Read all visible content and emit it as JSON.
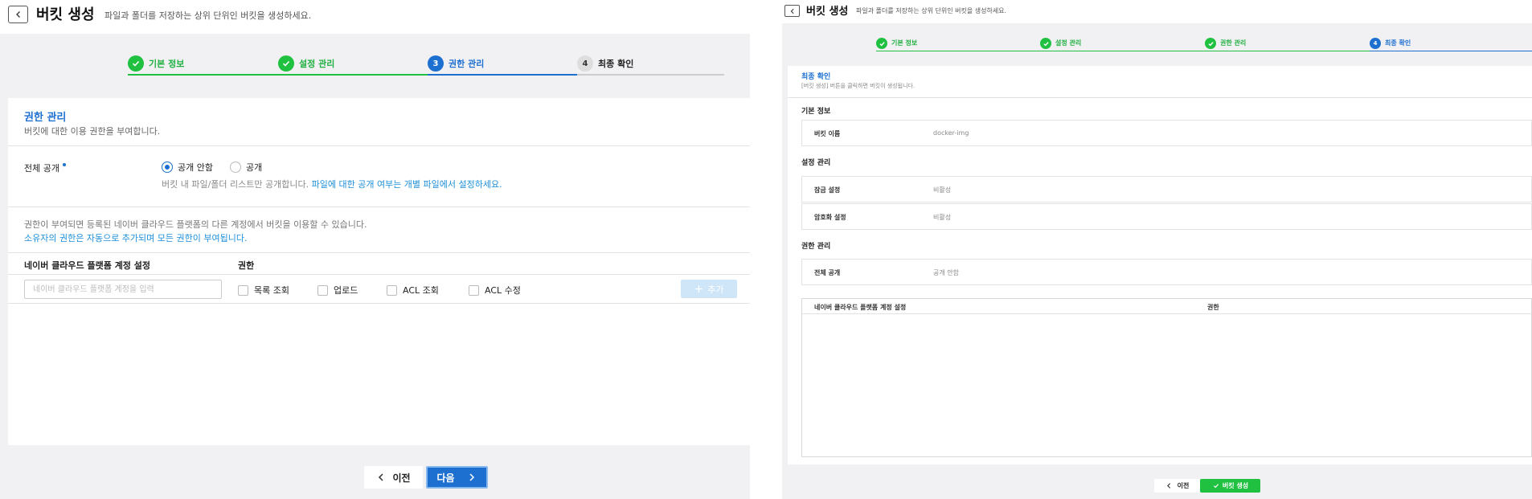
{
  "left": {
    "title": "버킷 생성",
    "subtitle": "파일과 폴더를 저장하는 상위 단위인 버킷을 생성하세요.",
    "steps": [
      {
        "num": "1",
        "label": "기본 정보",
        "state": "done"
      },
      {
        "num": "2",
        "label": "설정 관리",
        "state": "done"
      },
      {
        "num": "3",
        "label": "권한 관리",
        "state": "current"
      },
      {
        "num": "4",
        "label": "최종 확인",
        "state": "todo"
      }
    ],
    "section": {
      "title": "권한 관리",
      "description": "버킷에 대한 이용 권한을 부여합니다."
    },
    "public_access": {
      "label": "전체 공개",
      "options": [
        {
          "label": "공개 안함",
          "selected": true
        },
        {
          "label": "공개",
          "selected": false
        }
      ],
      "hint": "버킷 내 파일/폴더 리스트만 공개합니다. ",
      "hint_link": "파일에 대한 공개 여부는 개별 파일에서 설정하세요."
    },
    "info_line1": "권한이 부여되면 등록된 네이버 클라우드 플랫폼의 다른 계정에서 버킷을 이용할 수 있습니다.",
    "info_line2": "소유자의 권한은 자동으로 추가되며 모든 권한이 부여됩니다.",
    "table": {
      "col_account": "네이버 클라우드 플랫폼 계정 설정",
      "col_permission": "권한",
      "account_placeholder": "네이버 클라우드 플랫폼 계정을 입력",
      "permissions": [
        "목록 조회",
        "업로드",
        "ACL 조회",
        "ACL 수정"
      ],
      "add_label": "추가"
    },
    "prev_label": "이전",
    "next_label": "다음"
  },
  "right": {
    "title": "버킷 생성",
    "subtitle": "파일과 폴더를 저장하는 상위 단위인 버킷을 생성하세요.",
    "steps": [
      {
        "num": "1",
        "label": "기본 정보",
        "state": "done"
      },
      {
        "num": "2",
        "label": "설정 관리",
        "state": "done"
      },
      {
        "num": "3",
        "label": "권한 관리",
        "state": "done"
      },
      {
        "num": "4",
        "label": "최종 확인",
        "state": "current"
      }
    ],
    "section": {
      "title": "최종 확인",
      "description": "[버킷 생성] 버튼을 클릭하면 버킷이 생성됩니다."
    },
    "basic": {
      "title": "기본 정보",
      "bucket_name_label": "버킷 이름",
      "bucket_name_value": "docker-img"
    },
    "settings": {
      "title": "설정 관리",
      "lock_label": "잠금 설정",
      "lock_value": "비활성",
      "encryption_label": "암호화 설정",
      "encryption_value": "비활성"
    },
    "permissions": {
      "title": "권한 관리",
      "public_label": "전체 공개",
      "public_value": "공개 안함",
      "col_account": "네이버 클라우드 플랫폼 계정 설정",
      "col_permission": "권한"
    },
    "prev_label": "이전",
    "create_label": "버킷 생성"
  },
  "colors": {
    "primary": "#1d6fd0",
    "success": "#20c040",
    "link": "#1d8fd8",
    "background": "#f1f1f3"
  }
}
